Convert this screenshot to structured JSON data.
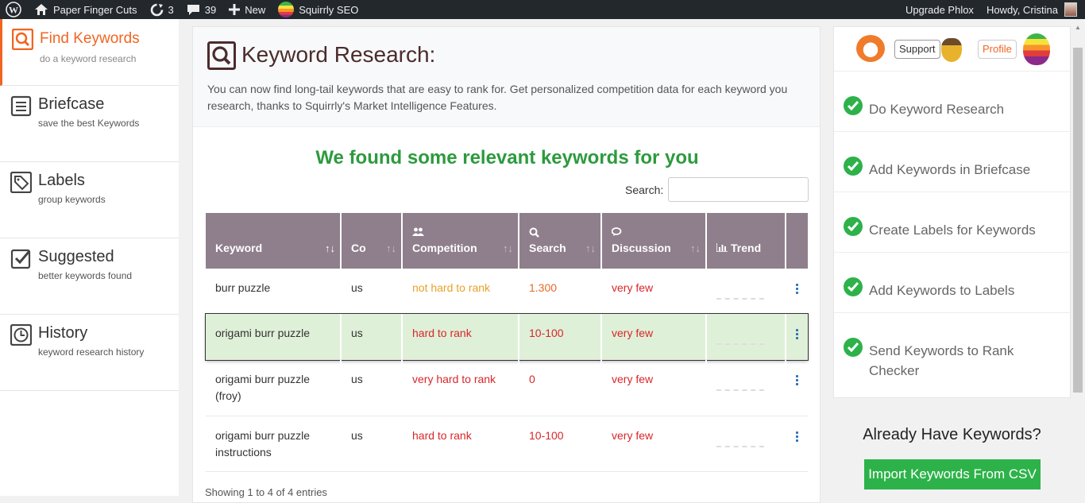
{
  "adminbar": {
    "site_name": "Paper Finger Cuts",
    "updates_count": "3",
    "comments_count": "39",
    "new_label": "New",
    "plugin_label": "Squirrly SEO",
    "upgrade_label": "Upgrade Phlox",
    "howdy_label": "Howdy, Cristina"
  },
  "nav": {
    "items": [
      {
        "title": "Find Keywords",
        "sub": "do a keyword research"
      },
      {
        "title": "Briefcase",
        "sub": "save the best Keywords"
      },
      {
        "title": "Labels",
        "sub": "group keywords"
      },
      {
        "title": "Suggested",
        "sub": "better keywords found"
      },
      {
        "title": "History",
        "sub": "keyword research history"
      }
    ]
  },
  "main": {
    "title": "Keyword Research:",
    "description": "You can now find long-tail keywords that are easy to rank for. Get personalized competition data for each keyword you research, thanks to Squirrly's Market Intelligence Features.",
    "found_heading": "We found some relevant keywords for you",
    "search_label": "Search:",
    "search_value": "",
    "columns": [
      "Keyword",
      "Co",
      "Competition",
      "Search",
      "Discussion",
      "Trend"
    ],
    "rows": [
      {
        "keyword": "burr puzzle",
        "co": "us",
        "competition": "not hard to rank",
        "search": "1.300",
        "discussion": "very few"
      },
      {
        "keyword": "origami burr puzzle",
        "co": "us",
        "competition": "hard to rank",
        "search": "10-100",
        "discussion": "very few"
      },
      {
        "keyword": "origami burr puzzle (froy)",
        "co": "us",
        "competition": "very hard to rank",
        "search": "0",
        "discussion": "very few"
      },
      {
        "keyword": "origami burr puzzle instructions",
        "co": "us",
        "competition": "hard to rank",
        "search": "10-100",
        "discussion": "very few"
      }
    ],
    "showing_text": "Showing 1 to 4 of 4 entries"
  },
  "right": {
    "support_label": "Support",
    "profile_label": "Profile",
    "checklist": [
      "Do Keyword Research",
      "Add Keywords in Briefcase",
      "Create Labels for Keywords",
      "Add Keywords to Labels",
      "Send Keywords to Rank Checker"
    ],
    "have_keywords_heading": "Already Have Keywords?",
    "import_button": "Import Keywords From CSV"
  },
  "colors": {
    "accent_orange": "#f16522",
    "success_green": "#2db24a",
    "header_mauve": "#8f7f8c"
  }
}
